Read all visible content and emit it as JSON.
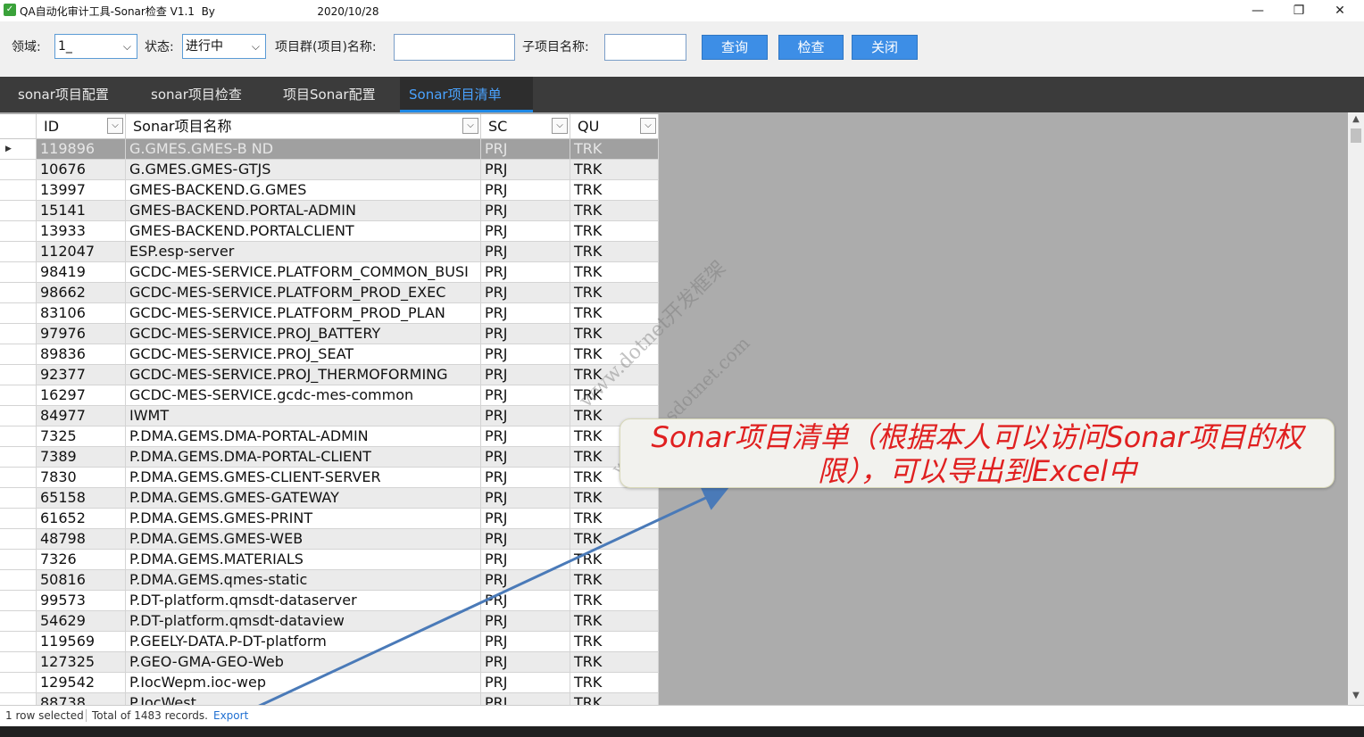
{
  "window": {
    "title": "QA自动化审计工具-Sonar检查 V1.1  By                              2020/10/28",
    "minimize": "—",
    "maximize": "❐",
    "close": "✕"
  },
  "toolbar": {
    "domain_label": "领域:",
    "domain_value": "1_",
    "status_label": "状态:",
    "status_value": "进行中",
    "group_label": "项目群(项目)名称:",
    "sub_label": "子项目名称:",
    "query_button": "查询",
    "check_button": "检查",
    "close_button": "关闭"
  },
  "tabs": [
    {
      "label": "sonar项目配置"
    },
    {
      "label": "sonar项目检查"
    },
    {
      "label": "项目Sonar配置"
    },
    {
      "label": "Sonar项目清单"
    }
  ],
  "grid": {
    "columns": [
      "ID",
      "Sonar项目名称",
      "SC",
      "QU"
    ],
    "rows": [
      {
        "id": "119896",
        "name": "G.GMES.GMES-B      ND",
        "sc": "PRJ",
        "qu": "TRK"
      },
      {
        "id": "10676",
        "name": "G.GMES.GMES-GTJS",
        "sc": "PRJ",
        "qu": "TRK"
      },
      {
        "id": "13997",
        "name": "GMES-BACKEND.G.GMES",
        "sc": "PRJ",
        "qu": "TRK"
      },
      {
        "id": "15141",
        "name": "GMES-BACKEND.PORTAL-ADMIN",
        "sc": "PRJ",
        "qu": "TRK"
      },
      {
        "id": "13933",
        "name": "GMES-BACKEND.PORTALCLIENT",
        "sc": "PRJ",
        "qu": "TRK"
      },
      {
        "id": "112047",
        "name": "ESP.esp-server",
        "sc": "PRJ",
        "qu": "TRK"
      },
      {
        "id": "98419",
        "name": "GCDC-MES-SERVICE.PLATFORM_COMMON_BUSI",
        "sc": "PRJ",
        "qu": "TRK"
      },
      {
        "id": "98662",
        "name": "GCDC-MES-SERVICE.PLATFORM_PROD_EXEC",
        "sc": "PRJ",
        "qu": "TRK"
      },
      {
        "id": "83106",
        "name": "GCDC-MES-SERVICE.PLATFORM_PROD_PLAN",
        "sc": "PRJ",
        "qu": "TRK"
      },
      {
        "id": "97976",
        "name": "GCDC-MES-SERVICE.PROJ_BATTERY",
        "sc": "PRJ",
        "qu": "TRK"
      },
      {
        "id": "89836",
        "name": "GCDC-MES-SERVICE.PROJ_SEAT",
        "sc": "PRJ",
        "qu": "TRK"
      },
      {
        "id": "92377",
        "name": "GCDC-MES-SERVICE.PROJ_THERMOFORMING",
        "sc": "PRJ",
        "qu": "TRK"
      },
      {
        "id": "16297",
        "name": "GCDC-MES-SERVICE.gcdc-mes-common",
        "sc": "PRJ",
        "qu": "TRK"
      },
      {
        "id": "84977",
        "name": "IWMT",
        "sc": "PRJ",
        "qu": "TRK"
      },
      {
        "id": "7325",
        "name": "P.DMA.GEMS.DMA-PORTAL-ADMIN",
        "sc": "PRJ",
        "qu": "TRK"
      },
      {
        "id": "7389",
        "name": "P.DMA.GEMS.DMA-PORTAL-CLIENT",
        "sc": "PRJ",
        "qu": "TRK"
      },
      {
        "id": "7830",
        "name": "P.DMA.GEMS.GMES-CLIENT-SERVER",
        "sc": "PRJ",
        "qu": "TRK"
      },
      {
        "id": "65158",
        "name": "P.DMA.GEMS.GMES-GATEWAY",
        "sc": "PRJ",
        "qu": "TRK"
      },
      {
        "id": "61652",
        "name": "P.DMA.GEMS.GMES-PRINT",
        "sc": "PRJ",
        "qu": "TRK"
      },
      {
        "id": "48798",
        "name": "P.DMA.GEMS.GMES-WEB",
        "sc": "PRJ",
        "qu": "TRK"
      },
      {
        "id": "7326",
        "name": "P.DMA.GEMS.MATERIALS",
        "sc": "PRJ",
        "qu": "TRK"
      },
      {
        "id": "50816",
        "name": "P.DMA.GEMS.qmes-static",
        "sc": "PRJ",
        "qu": "TRK"
      },
      {
        "id": "99573",
        "name": "P.DT-platform.qmsdt-dataserver",
        "sc": "PRJ",
        "qu": "TRK"
      },
      {
        "id": "54629",
        "name": "P.DT-platform.qmsdt-dataview",
        "sc": "PRJ",
        "qu": "TRK"
      },
      {
        "id": "119569",
        "name": "P.GEELY-DATA.P-DT-platform",
        "sc": "PRJ",
        "qu": "TRK"
      },
      {
        "id": "127325",
        "name": "P.GEO-GMA-GEO-Web",
        "sc": "PRJ",
        "qu": "TRK"
      },
      {
        "id": "129542",
        "name": "P.IocWepm.ioc-wep",
        "sc": "PRJ",
        "qu": "TRK"
      },
      {
        "id": "88738",
        "name": "P.IocWest",
        "sc": "PRJ",
        "qu": "TRK"
      }
    ]
  },
  "statusbar": {
    "selected": "1 row selected",
    "total": "Total of 1483 records.",
    "export": "Export"
  },
  "watermark": {
    "line1": "www.dotnet开发框架",
    "line2": "www.wesdotnet.com"
  },
  "callout": {
    "text": "Sonar项目清单（根据本人可以访问Sonar项目的权限），可以导出到Excel中"
  },
  "colors": {
    "accent": "#3d8ee6",
    "callout_text": "#e02020",
    "tab_active": "#4aa3ff",
    "arrow": "#4a7ab8"
  }
}
